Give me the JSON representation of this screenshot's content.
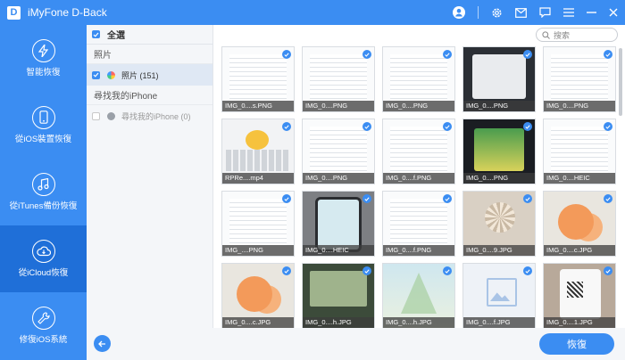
{
  "app": {
    "title": "iMyFone D-Back",
    "logo_letter": "D"
  },
  "titlebar_icons": [
    "account-icon",
    "settings-icon",
    "mail-icon",
    "feedback-icon",
    "menu-icon",
    "minimize-icon",
    "close-icon"
  ],
  "sidebar": {
    "items": [
      {
        "label": "智能恢復",
        "icon": "lightning-icon",
        "active": false
      },
      {
        "label": "從iOS裝置恢復",
        "icon": "phone-icon",
        "active": false
      },
      {
        "label": "從iTunes備份恢復",
        "icon": "music-icon",
        "active": false
      },
      {
        "label": "從iCloud恢復",
        "icon": "cloud-icon",
        "active": true
      },
      {
        "label": "修復iOS系統",
        "icon": "wrench-icon",
        "active": false
      }
    ]
  },
  "tree": {
    "select_all": "全選",
    "group_photos": "照片",
    "photos_item": "照片 (151)",
    "group_find": "尋找我的iPhone",
    "find_item": "尋找我的iPhone (0)"
  },
  "search": {
    "placeholder": "搜索"
  },
  "tiles": [
    {
      "label": "IMG_0....s.PNG",
      "style": "t-screen",
      "checked": true
    },
    {
      "label": "IMG_0....PNG",
      "style": "t-screen",
      "checked": true
    },
    {
      "label": "IMG_0....PNG",
      "style": "t-screen",
      "checked": true
    },
    {
      "label": "IMG_0....PNG",
      "style": "t-dark",
      "checked": true
    },
    {
      "label": "IMG_0....PNG",
      "style": "t-screen",
      "checked": true
    },
    {
      "label": "RPRe....mp4",
      "style": "t-kbd",
      "checked": true
    },
    {
      "label": "IMG_0....PNG",
      "style": "t-screen",
      "checked": true
    },
    {
      "label": "IMG_0....f.PNG",
      "style": "t-screen",
      "checked": true
    },
    {
      "label": "IMG_0....PNG",
      "style": "t-poke",
      "checked": true
    },
    {
      "label": "IMG_0....HEIC",
      "style": "t-screen",
      "checked": true
    },
    {
      "label": "IMG_....PNG",
      "style": "t-screen",
      "checked": true
    },
    {
      "label": "IMG_0....HEIC",
      "style": "t-phone",
      "checked": true
    },
    {
      "label": "IMG_0....f.PNG",
      "style": "t-screen",
      "checked": true
    },
    {
      "label": "IMG_0....9.JPG",
      "style": "t-fan",
      "checked": true
    },
    {
      "label": "IMG_0....c.JPG",
      "style": "t-citrus",
      "checked": true
    },
    {
      "label": "IMG_0....c.JPG",
      "style": "t-citrus",
      "checked": true
    },
    {
      "label": "IMG_0....h.JPG",
      "style": "t-laptop",
      "checked": true
    },
    {
      "label": "IMG_0....h.JPG",
      "style": "t-sky",
      "checked": true
    },
    {
      "label": "IMG_0....f.JPG",
      "style": "t-placeholder",
      "checked": true
    },
    {
      "label": "IMG_0....1.JPG",
      "style": "t-qr",
      "checked": true
    }
  ],
  "bottom": {
    "recover_label": "恢復"
  },
  "colors": {
    "accent": "#3b8df2",
    "accent_dark": "#1f6fd8",
    "panel": "#f4f6f9"
  }
}
